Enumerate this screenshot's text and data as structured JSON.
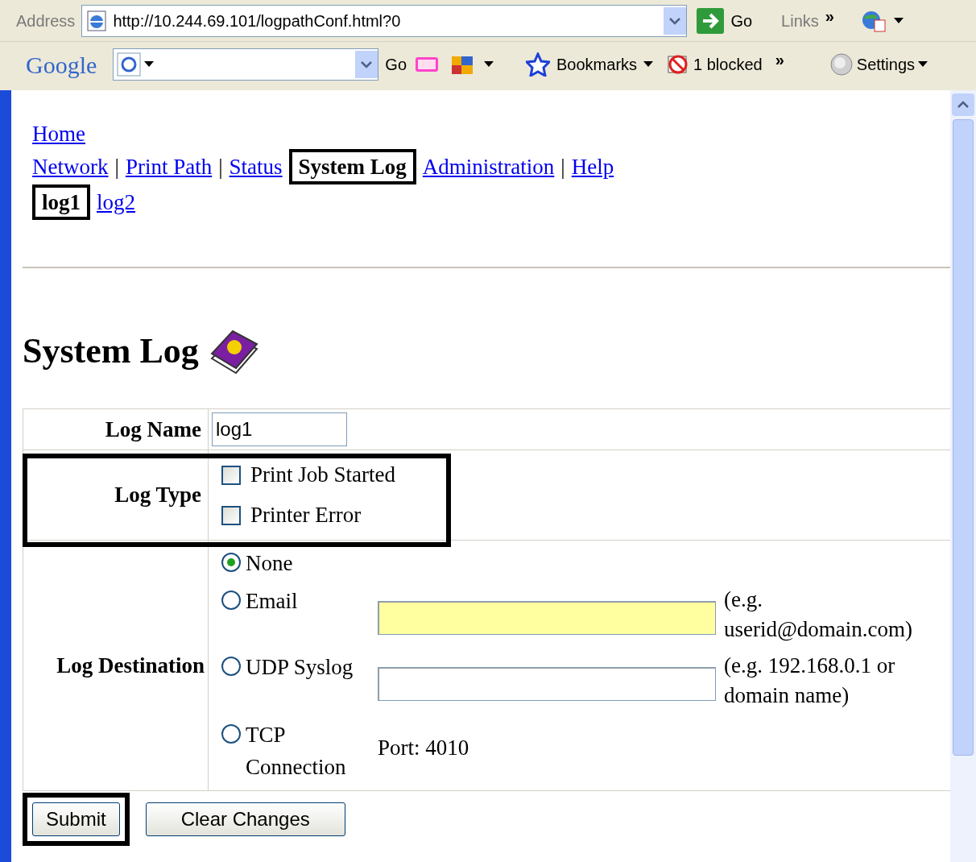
{
  "address_bar": {
    "label": "Address",
    "url": "http://10.244.69.101/logpathConf.html?0",
    "go": "Go",
    "links": "Links",
    "chevron": "»"
  },
  "google_bar": {
    "logo": "Google",
    "go": "Go",
    "bookmarks": "Bookmarks",
    "blocked": "1 blocked",
    "chevron": "»",
    "settings": "Settings"
  },
  "home_link": "Home",
  "nav": [
    {
      "label": "Network",
      "selected": false,
      "separator": "|"
    },
    {
      "label": "Print Path",
      "selected": false,
      "separator": "|"
    },
    {
      "label": "Status",
      "selected": false
    },
    {
      "label": "System Log",
      "selected": true
    },
    {
      "label": "Administration",
      "selected": false,
      "separator": "|"
    },
    {
      "label": "Help",
      "selected": false
    }
  ],
  "subnav": [
    {
      "label": "log1",
      "selected": true
    },
    {
      "label": "log2",
      "selected": false
    }
  ],
  "heading": "System Log",
  "form": {
    "log_name": {
      "label": "Log Name",
      "value": "log1"
    },
    "log_type": {
      "label": "Log Type",
      "options": [
        {
          "label": "Print Job Started",
          "checked": false
        },
        {
          "label": "Printer Error",
          "checked": false
        }
      ]
    },
    "log_destination": {
      "label": "Log Destination",
      "options": [
        {
          "label": "None",
          "selected": true,
          "kind": "plain"
        },
        {
          "label": "Email",
          "selected": false,
          "kind": "field",
          "highlighted": true,
          "hint": "(e.g. userid@domain.com)"
        },
        {
          "label": "UDP Syslog",
          "selected": false,
          "kind": "field",
          "highlighted": false,
          "hint": "(e.g. 192.168.0.1 or domain name)"
        },
        {
          "label": "TCP Connection",
          "selected": false,
          "kind": "port",
          "port": "Port: 4010"
        }
      ]
    }
  },
  "buttons": [
    {
      "label": "Submit",
      "framed": true
    },
    {
      "label": "Clear Changes",
      "framed": false
    }
  ]
}
